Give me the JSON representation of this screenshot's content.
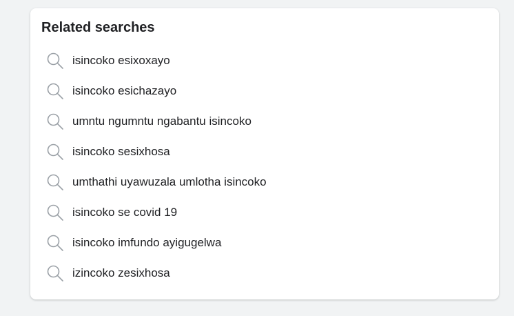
{
  "related": {
    "title": "Related searches",
    "icon": "search-icon",
    "items": [
      {
        "label": "isincoko esixoxayo"
      },
      {
        "label": "isincoko esichazayo"
      },
      {
        "label": "umntu ngumntu ngabantu isincoko"
      },
      {
        "label": "isincoko sesixhosa"
      },
      {
        "label": "umthathi uyawuzala umlotha isincoko"
      },
      {
        "label": "isincoko se covid 19"
      },
      {
        "label": "isincoko imfundo ayigugelwa"
      },
      {
        "label": "izincoko zesixhosa"
      }
    ]
  }
}
